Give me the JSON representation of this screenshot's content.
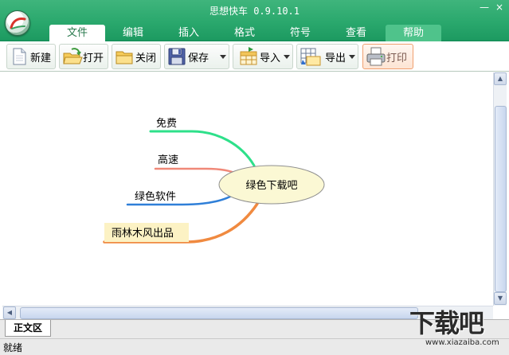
{
  "window": {
    "title": "思想快车 0.9.10.1",
    "controls": [
      "—",
      "×"
    ]
  },
  "tabs": [
    {
      "label": "文件",
      "active": true
    },
    {
      "label": "编辑"
    },
    {
      "label": "插入"
    },
    {
      "label": "格式"
    },
    {
      "label": "符号"
    },
    {
      "label": "查看"
    },
    {
      "label": "帮助"
    }
  ],
  "toolbar": {
    "new": "新建",
    "open": "打开",
    "close": "关闭",
    "save": "保存",
    "import": "导入",
    "export": "导出",
    "print": "打印"
  },
  "mindmap": {
    "central": "绿色下载吧",
    "branches": [
      {
        "label": "免费",
        "color": "#2ee08a"
      },
      {
        "label": "高速",
        "color": "#f08878"
      },
      {
        "label": "绿色软件",
        "color": "#2f7fd8"
      },
      {
        "label": "雨林木风出品",
        "color": "#f08a40"
      }
    ]
  },
  "sheet_tab": "正文区",
  "status": "就绪",
  "watermark": {
    "logo": "下载吧",
    "url": "www.xiazaiba.com"
  },
  "colors": {
    "ribbon": "#1d9a61",
    "central_fill": "#fbf8d4",
    "last_branch_fill": "#fcf2c4"
  }
}
